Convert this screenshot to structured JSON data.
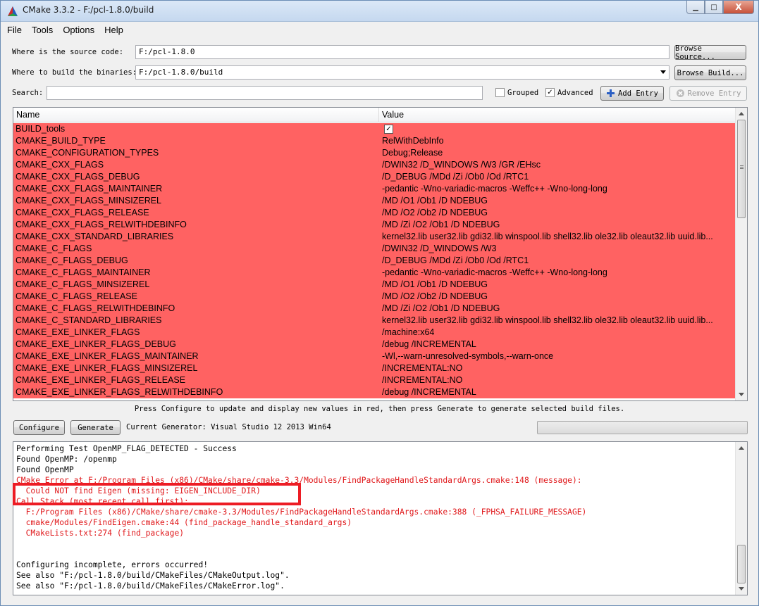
{
  "window": {
    "title": "CMake 3.3.2 - F:/pcl-1.8.0/build",
    "minimize": "▁",
    "maximize": "□",
    "close": "X"
  },
  "menu": [
    "File",
    "Tools",
    "Options",
    "Help"
  ],
  "source": {
    "label": "Where is the source code:",
    "value": "F:/pcl-1.8.0",
    "button": "Browse Source..."
  },
  "build": {
    "label": "Where to build the binaries:",
    "value": "F:/pcl-1.8.0/build",
    "button": "Browse Build..."
  },
  "search": {
    "label": "Search:",
    "value": "",
    "grouped_label": "Grouped",
    "grouped_checked": false,
    "advanced_label": "Advanced",
    "advanced_checked": true,
    "add_entry": "Add Entry",
    "remove_entry": "Remove Entry"
  },
  "table": {
    "columns": [
      "Name",
      "Value"
    ],
    "rows": [
      {
        "name": "BUILD_tools",
        "value": "",
        "checkbox": true
      },
      {
        "name": "CMAKE_BUILD_TYPE",
        "value": "RelWithDebInfo"
      },
      {
        "name": "CMAKE_CONFIGURATION_TYPES",
        "value": "Debug;Release"
      },
      {
        "name": "CMAKE_CXX_FLAGS",
        "value": " /DWIN32 /D_WINDOWS /W3 /GR /EHsc"
      },
      {
        "name": "CMAKE_CXX_FLAGS_DEBUG",
        "value": "/D_DEBUG /MDd /Zi /Ob0 /Od /RTC1"
      },
      {
        "name": "CMAKE_CXX_FLAGS_MAINTAINER",
        "value": "-pedantic -Wno-variadic-macros -Weffc++ -Wno-long-long"
      },
      {
        "name": "CMAKE_CXX_FLAGS_MINSIZEREL",
        "value": "/MD /O1 /Ob1 /D NDEBUG"
      },
      {
        "name": "CMAKE_CXX_FLAGS_RELEASE",
        "value": "/MD /O2 /Ob2 /D NDEBUG"
      },
      {
        "name": "CMAKE_CXX_FLAGS_RELWITHDEBINFO",
        "value": "/MD /Zi /O2 /Ob1 /D NDEBUG"
      },
      {
        "name": "CMAKE_CXX_STANDARD_LIBRARIES",
        "value": "kernel32.lib user32.lib gdi32.lib winspool.lib shell32.lib ole32.lib oleaut32.lib uuid.lib..."
      },
      {
        "name": "CMAKE_C_FLAGS",
        "value": " /DWIN32 /D_WINDOWS /W3"
      },
      {
        "name": "CMAKE_C_FLAGS_DEBUG",
        "value": "/D_DEBUG /MDd /Zi /Ob0 /Od /RTC1"
      },
      {
        "name": "CMAKE_C_FLAGS_MAINTAINER",
        "value": "-pedantic -Wno-variadic-macros -Weffc++ -Wno-long-long"
      },
      {
        "name": "CMAKE_C_FLAGS_MINSIZEREL",
        "value": "/MD /O1 /Ob1 /D NDEBUG"
      },
      {
        "name": "CMAKE_C_FLAGS_RELEASE",
        "value": "/MD /O2 /Ob2 /D NDEBUG"
      },
      {
        "name": "CMAKE_C_FLAGS_RELWITHDEBINFO",
        "value": "/MD /Zi /O2 /Ob1 /D NDEBUG"
      },
      {
        "name": "CMAKE_C_STANDARD_LIBRARIES",
        "value": "kernel32.lib user32.lib gdi32.lib winspool.lib shell32.lib ole32.lib oleaut32.lib uuid.lib..."
      },
      {
        "name": "CMAKE_EXE_LINKER_FLAGS",
        "value": " /machine:x64"
      },
      {
        "name": "CMAKE_EXE_LINKER_FLAGS_DEBUG",
        "value": "/debug /INCREMENTAL"
      },
      {
        "name": "CMAKE_EXE_LINKER_FLAGS_MAINTAINER",
        "value": "-Wl,--warn-unresolved-symbols,--warn-once"
      },
      {
        "name": "CMAKE_EXE_LINKER_FLAGS_MINSIZEREL",
        "value": "/INCREMENTAL:NO"
      },
      {
        "name": "CMAKE_EXE_LINKER_FLAGS_RELEASE",
        "value": "/INCREMENTAL:NO"
      },
      {
        "name": "CMAKE_EXE_LINKER_FLAGS_RELWITHDEBINFO",
        "value": "/debug /INCREMENTAL"
      }
    ],
    "highlight_color": "#ff6262"
  },
  "hint": "Press Configure to update and display new values in red, then press Generate to generate selected build files.",
  "actions": {
    "configure": "Configure",
    "generate": "Generate",
    "generator": "Current Generator: Visual Studio 12 2013 Win64"
  },
  "output": {
    "lines": [
      {
        "text": "Performing Test OpenMP_FLAG_DETECTED - Success",
        "red": false
      },
      {
        "text": "Found OpenMP: /openmp",
        "red": false
      },
      {
        "text": "Found OpenMP",
        "red": false
      },
      {
        "text": "CMake Error at F:/Program Files (x86)/CMake/share/cmake-3.3/Modules/FindPackageHandleStandardArgs.cmake:148 (message):",
        "red": true
      },
      {
        "text": "  Could NOT find Eigen (missing: EIGEN_INCLUDE_DIR)",
        "red": true
      },
      {
        "text": "Call Stack (most recent call first):",
        "red": true
      },
      {
        "text": "  F:/Program Files (x86)/CMake/share/cmake-3.3/Modules/FindPackageHandleStandardArgs.cmake:388 (_FPHSA_FAILURE_MESSAGE)",
        "red": true
      },
      {
        "text": "  cmake/Modules/FindEigen.cmake:44 (find_package_handle_standard_args)",
        "red": true
      },
      {
        "text": "  CMakeLists.txt:274 (find_package)",
        "red": true
      },
      {
        "text": "",
        "red": false
      },
      {
        "text": "",
        "red": false
      },
      {
        "text": "Configuring incomplete, errors occurred!",
        "red": false
      },
      {
        "text": "See also \"F:/pcl-1.8.0/build/CMakeFiles/CMakeOutput.log\".",
        "red": false
      },
      {
        "text": "See also \"F:/pcl-1.8.0/build/CMakeFiles/CMakeError.log\".",
        "red": false
      }
    ],
    "error_color": "#e0181b",
    "annotation_color": "#ed1c24"
  }
}
